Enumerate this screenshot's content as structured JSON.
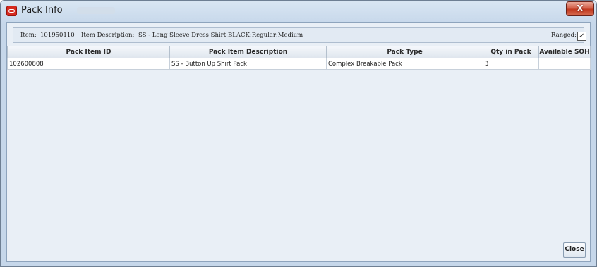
{
  "window": {
    "title": "Pack Info",
    "close_glyph": "X"
  },
  "info": {
    "item_label": "Item:",
    "item_value": "101950110",
    "desc_label": "Item Description:",
    "desc_value": "SS - Long Sleeve Dress Shirt:BLACK:Regular:Medium",
    "ranged_label": "Ranged:",
    "ranged_checked": true,
    "ranged_mark": "✓"
  },
  "table": {
    "columns": [
      "Pack Item ID",
      "Pack Item Description",
      "Pack Type",
      "Qty in Pack",
      "Available SOH"
    ],
    "rows": [
      [
        "102600808",
        "SS - Button Up Shirt Pack",
        "Complex Breakable Pack",
        "3",
        ""
      ]
    ]
  },
  "footer": {
    "close_first": "C",
    "close_rest": "lose"
  },
  "icons": {
    "app": "oracle-app-icon",
    "close": "close-icon",
    "checkbox": "checkbox-icon"
  },
  "colors": {
    "accent_close": "#c0391f",
    "frame": "#c6d7ea"
  }
}
